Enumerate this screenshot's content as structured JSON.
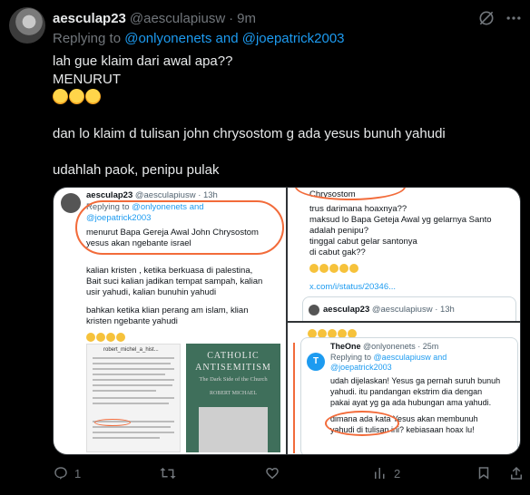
{
  "author": {
    "name": "aesculap23",
    "handle": "@aesculapiusw",
    "dot": "·",
    "time": "9m"
  },
  "reply": {
    "prefix": "Replying to",
    "user1": "@onlyonenets",
    "and": "and",
    "user2": "@joepatrick2003"
  },
  "body": {
    "line1": "lah gue klaim dari awal apa??",
    "line2": "MENURUT",
    "line3": "dan lo klaim d tulisan john chrysostom  g ada yesus bunuh yahudi",
    "line4": "udahlah paok, penipu pulak",
    "emoji_count": 3
  },
  "media": {
    "p1": {
      "name": "aesculap23",
      "handle": "@aesculapiusw · 13h",
      "replying": "Replying to",
      "reply_users": "@onlyonenets and",
      "reply_user2": "@joepatrick2003",
      "quote1": "menurut Bapa Gereja Awal John Chrysostom",
      "quote2": "yesus akan ngebante israel",
      "para1a": "kalian kristen , ketika berkuasa di palestina,",
      "para1b": "Bait suci kalian jadikan tempat sampah, kalian",
      "para1c": "usir yahudi, kalian bunuhin yahudi",
      "para2a": "bahkan ketika klian perang am islam, klian",
      "para2b": "kristen ngebante yahudi",
      "doc_name": "robert_michel_a_hist...",
      "book_title1": "CATHOLIC",
      "book_title2": "ANTISEMITISM",
      "book_sub": "The Dark Side of the Church",
      "book_author": "ROBERT MICHAEL"
    },
    "p2": {
      "l1": "Chrysostom",
      "l2": "trus darimana hoaxnya??",
      "l3": "maksud lo Bapa Geteja Awal yg gelarnya Santo",
      "l4": "adalah penipu?",
      "l5": "tinggal cabut gelar santonya",
      "l6": "di cabut gak??",
      "link": "x.com/i/status/20346...",
      "quote_name": "aesculap23",
      "quote_handle": "@aesculapiusw · 13h"
    },
    "p3": {
      "name": "TheOne",
      "handle": "@onlyonenets · 25m",
      "replying": "Replying to",
      "reply1": "@aesculapiusw and",
      "reply2": "@joepatrick2003",
      "t1": "udah dijelaskan! Yesus ga pernah suruh bunuh",
      "t2": "yahudi. itu pandangan ekstrim dia dengan",
      "t3": "pakai ayat yg ga ada hubungan ama yahudi.",
      "t4": "dimana ada kata Yesus akan membunuh",
      "t5": "yahudi di tulisan ini? kebiasaan hoax lu!",
      "avatar_letter": "T"
    }
  },
  "actions": {
    "replies": "1",
    "reposts": "",
    "likes": "",
    "views": "2"
  },
  "colors": {
    "link": "#1d9bf0",
    "muted": "#71767b",
    "annotation": "#f26b3a"
  }
}
